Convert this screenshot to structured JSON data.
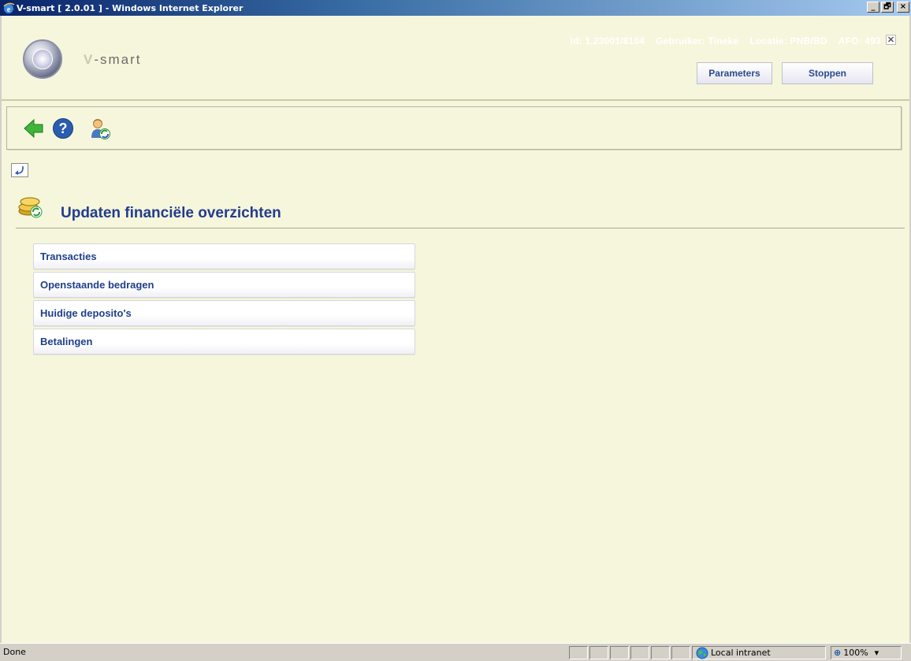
{
  "window": {
    "title": "V-smart [ 2.0.01 ] - Windows Internet Explorer",
    "minimize": "_",
    "maximize": "🗗",
    "close": "×"
  },
  "header": {
    "brand_prefix": "V",
    "brand_rest": "-smart",
    "session": {
      "id": "Id: 1.23001/8104",
      "user": "Gebruiker: Tineke",
      "location": "Locatie: PNB/BD",
      "afo": "AFO: 493"
    },
    "close_label": "✕",
    "buttons": {
      "parameters": "Parameters",
      "stop": "Stoppen"
    }
  },
  "toolbar": {
    "icons": [
      "back-arrow-icon",
      "help-icon",
      "user-refresh-icon"
    ]
  },
  "page": {
    "title": "Updaten financiële overzichten",
    "menu_items": [
      {
        "label": "Transacties"
      },
      {
        "label": "Openstaande bedragen"
      },
      {
        "label": "Huidige deposito's"
      },
      {
        "label": "Betalingen"
      }
    ]
  },
  "statusbar": {
    "status": "Done",
    "zone": "Local intranet",
    "zoom": "100%"
  },
  "colors": {
    "background": "#f6f6dc",
    "title_text": "#223c8e",
    "link_text": "#1f3f8a"
  }
}
